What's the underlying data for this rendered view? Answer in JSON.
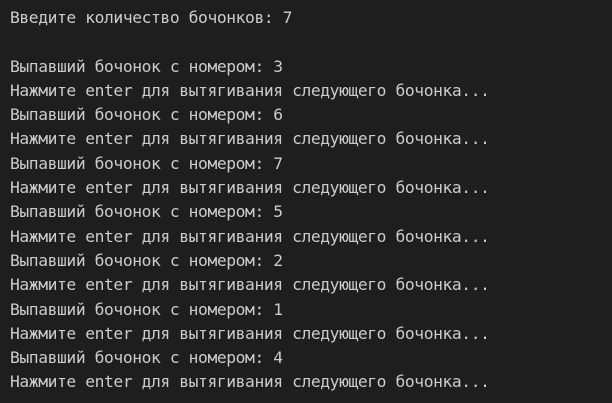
{
  "terminal": {
    "prompt": "Введите количество бочонков: 7",
    "entries": [
      {
        "drawn": "Выпавший бочонок с номером: 3",
        "prompt": "Нажмите enter для вытягивания следующего бочонка..."
      },
      {
        "drawn": "Выпавший бочонок с номером: 6",
        "prompt": "Нажмите enter для вытягивания следующего бочонка..."
      },
      {
        "drawn": "Выпавший бочонок с номером: 7",
        "prompt": "Нажмите enter для вытягивания следующего бочонка..."
      },
      {
        "drawn": "Выпавший бочонок с номером: 5",
        "prompt": "Нажмите enter для вытягивания следующего бочонка..."
      },
      {
        "drawn": "Выпавший бочонок с номером: 2",
        "prompt": "Нажмите enter для вытягивания следующего бочонка..."
      },
      {
        "drawn": "Выпавший бочонок с номером: 1",
        "prompt": "Нажмите enter для вытягивания следующего бочонка..."
      },
      {
        "drawn": "Выпавший бочонок с номером: 4",
        "prompt": "Нажмите enter для вытягивания следующего бочонка..."
      }
    ]
  },
  "colors": {
    "background": "#1e1e1e",
    "text": "#cccccc"
  }
}
